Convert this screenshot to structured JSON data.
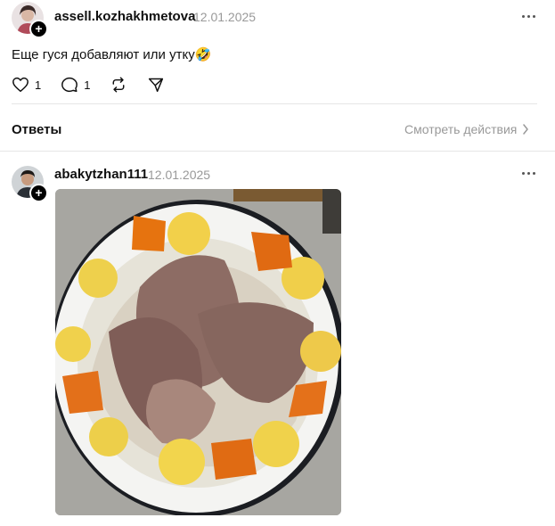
{
  "post": {
    "username": "assell.kozhakhmetova",
    "date": "12.01.2025",
    "text": "Еще гуся добавляют или утку",
    "emoji": "🤣",
    "likes": "1",
    "comments": "1"
  },
  "replies": {
    "title": "Ответы",
    "view_activity": "Смотреть действия"
  },
  "reply": {
    "username": "abakytzhan111",
    "date": "12.01.2025"
  },
  "icons": {
    "like": "heart-icon",
    "comment": "comment-bubble-icon",
    "repost": "repost-icon",
    "share": "send-icon",
    "more": "more-icon",
    "chevron": "chevron-right-icon",
    "follow": "plus-icon"
  },
  "colors": {
    "text": "#101010",
    "secondary": "#999999",
    "divider": "#e6e6e6"
  }
}
